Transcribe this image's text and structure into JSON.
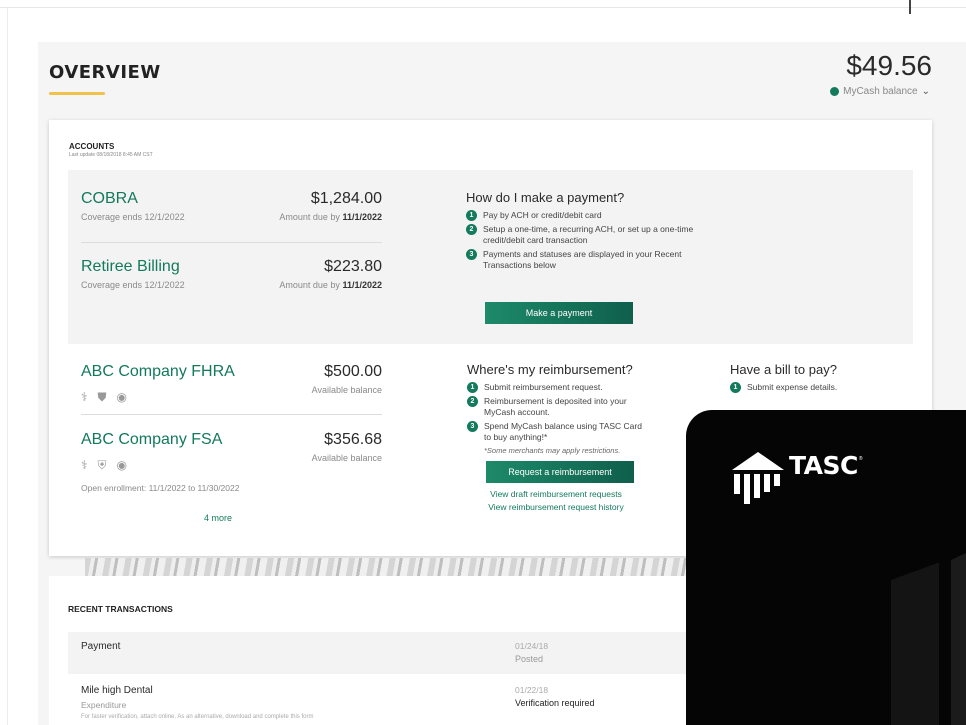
{
  "overview": {
    "title": "OVERVIEW",
    "balance_amount": "$49.56",
    "balance_label": "MyCash balance"
  },
  "accounts": {
    "title": "ACCOUNTS",
    "last_update": "Last update 08/18/2018 8:45 AM CST",
    "payment_items": [
      {
        "name": "COBRA",
        "sub": "Coverage ends 12/1/2022",
        "amount": "$1,284.00",
        "due_label": "Amount due by",
        "due_date": "11/1/2022"
      },
      {
        "name": "Retiree Billing",
        "sub": "Coverage ends 12/1/2022",
        "amount": "$223.80",
        "due_label": "Amount due by",
        "due_date": "11/1/2022"
      }
    ],
    "benefit_items": [
      {
        "name": "ABC Company FHRA",
        "amount": "$500.00",
        "amount_label": "Available balance",
        "icons": [
          "stethoscope-icon",
          "tooth-icon",
          "eye-icon"
        ]
      },
      {
        "name": "ABC Company FSA",
        "amount": "$356.68",
        "amount_label": "Available balance",
        "icons": [
          "stethoscope-icon",
          "pill-icon",
          "eye-icon"
        ],
        "enrollment": "Open enrollment: 11/1/2022 to 11/30/2022"
      }
    ],
    "more_link": "4 more"
  },
  "how_to_pay": {
    "title": "How do I make a payment?",
    "steps": [
      "Pay by ACH or credit/debit card",
      "Setup a one-time, a recurring ACH, or set up a one-time credit/debit card transaction",
      "Payments and statuses are displayed in your Recent Transactions below"
    ],
    "button": "Make a payment"
  },
  "reimbursement": {
    "title": "Where's my reimbursement?",
    "steps": [
      "Submit reimbursement request.",
      "Reimbursement is deposited into your MyCash account.",
      "Spend MyCash balance using TASC Card to buy anything!*"
    ],
    "note": "*Some merchants may apply restrictions.",
    "button": "Request a reimbursement",
    "links": [
      "View draft reimbursement requests",
      "View reimbursement request history"
    ]
  },
  "bill": {
    "title": "Have a bill to pay?",
    "steps": [
      "Submit expense details."
    ]
  },
  "recent": {
    "title": "RECENT TRANSACTIONS",
    "rows": [
      {
        "name": "Payment",
        "sub": "",
        "date": "01/24/18",
        "status": "Posted"
      },
      {
        "name": "Mile high Dental",
        "sub": "Expenditure",
        "date": "01/22/18",
        "status": "Verification required",
        "help": "For faster verification, attach online. As an alternative, download and complete this form"
      }
    ]
  },
  "brand": {
    "logo_text": "TASC",
    "accent": "#137a5c",
    "underline": "#f0c24a"
  }
}
